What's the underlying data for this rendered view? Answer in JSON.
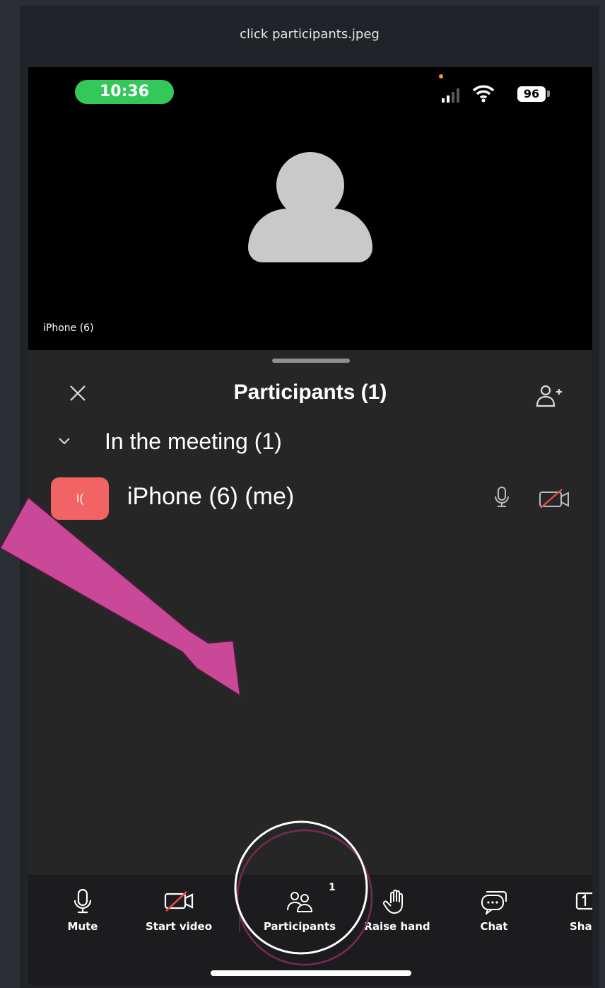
{
  "viewer": {
    "title": "click participants.jpeg"
  },
  "status_bar": {
    "time": "10:36",
    "battery": "96"
  },
  "video": {
    "tile_label": "iPhone (6)"
  },
  "panel": {
    "title": "Participants (1)",
    "section_title": "In the meeting (1)",
    "participants": [
      {
        "initials": "I(",
        "name": "iPhone (6) (me)",
        "avatar_color": "#f26363"
      }
    ]
  },
  "toolbar": {
    "mute": "Mute",
    "start_video": "Start video",
    "participants": "Participants",
    "participants_count": "1",
    "raise_hand": "Raise hand",
    "chat": "Chat",
    "share": "Sha"
  },
  "annotation": {
    "arrow_color": "#c94897",
    "circle_color": "#ffffff"
  }
}
